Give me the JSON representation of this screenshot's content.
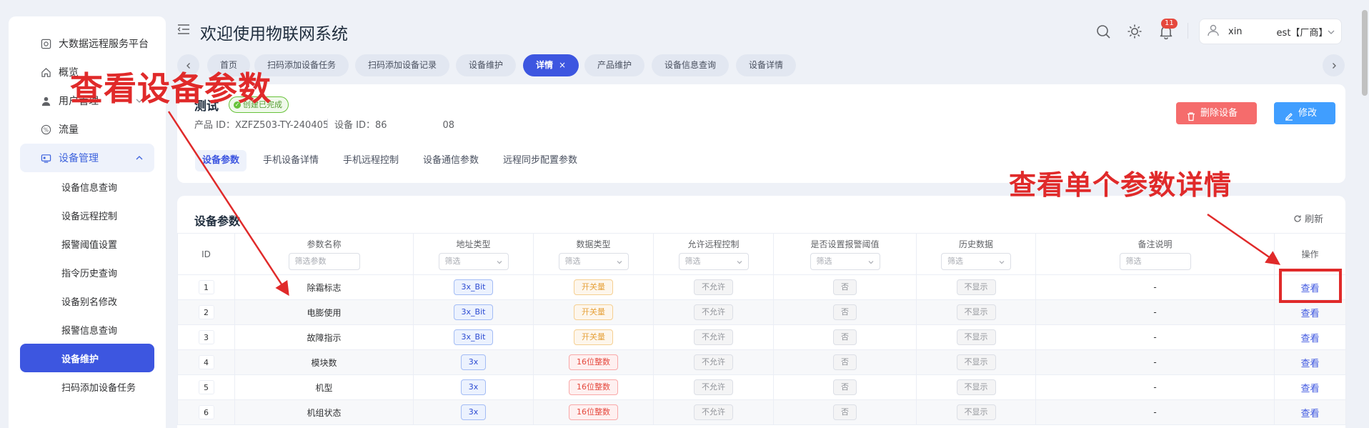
{
  "sidebar": {
    "items": [
      {
        "label": "大数据远程服务平台",
        "icon": "dashboard-icon"
      },
      {
        "label": "概览",
        "icon": "home-icon"
      },
      {
        "label": "用户管理",
        "icon": "user-icon",
        "expandable": true
      },
      {
        "label": "流量",
        "icon": "percent-icon"
      },
      {
        "label": "设备管理",
        "icon": "device-icon",
        "expanded": true
      }
    ],
    "sub_items": [
      "设备信息查询",
      "设备远程控制",
      "报警阈值设置",
      "指令历史查询",
      "设备别名修改",
      "报警信息查询",
      "设备维护",
      "扫码添加设备任务"
    ],
    "active_sub": "设备维护"
  },
  "header": {
    "title": "欢迎使用物联网系统",
    "notification_count": "11",
    "user": {
      "name_start": "xin",
      "name_end": "est【厂商】"
    }
  },
  "tabs": [
    {
      "label": "首页"
    },
    {
      "label": "扫码添加设备任务"
    },
    {
      "label": "扫码添加设备记录"
    },
    {
      "label": "设备维护"
    },
    {
      "label": "详情",
      "active": true,
      "close": "×"
    },
    {
      "label": "产品维护"
    },
    {
      "label": "设备信息查询"
    },
    {
      "label": "设备详情"
    }
  ],
  "device": {
    "name": "测试",
    "status": "创建已完成",
    "product_id_label": "产品 ID：",
    "product_id": "XZFZ503-TY-240405",
    "device_id_label": "设备 ID：",
    "device_id_start": "86",
    "device_id_end": "08",
    "delete_button": "删除设备",
    "edit_button": "修改"
  },
  "sub_tabs": [
    {
      "label": "设备参数",
      "active": true
    },
    {
      "label": "手机设备详情"
    },
    {
      "label": "手机远程控制"
    },
    {
      "label": "设备通信参数"
    },
    {
      "label": "远程同步配置参数"
    }
  ],
  "annotations": {
    "left": "查看设备参数",
    "right": "查看单个参数详情",
    "color": "#e02a2a"
  },
  "params_section": {
    "title": "设备参数",
    "refresh": "刷新",
    "columns": {
      "id": "ID",
      "name": "参数名称",
      "addr_type": "地址类型",
      "data_type": "数据类型",
      "remote": "允许远程控制",
      "alarm": "是否设置报警阈值",
      "history": "历史数据",
      "remark": "备注说明",
      "action": "操作"
    },
    "filters": {
      "name_placeholder": "筛选参数",
      "select_placeholder": "筛选",
      "remark_placeholder": "筛选"
    },
    "rows": [
      {
        "id": "1",
        "name": "除霜标志",
        "addr_type": "3x_Bit",
        "data_type": "开关量",
        "dt_style": "orange",
        "remote": "不允许",
        "alarm": "否",
        "history": "不显示",
        "remark": "-",
        "action": "查看"
      },
      {
        "id": "2",
        "name": "电膨使用",
        "addr_type": "3x_Bit",
        "data_type": "开关量",
        "dt_style": "orange",
        "remote": "不允许",
        "alarm": "否",
        "history": "不显示",
        "remark": "-",
        "action": "查看"
      },
      {
        "id": "3",
        "name": "故障指示",
        "addr_type": "3x_Bit",
        "data_type": "开关量",
        "dt_style": "orange",
        "remote": "不允许",
        "alarm": "否",
        "history": "不显示",
        "remark": "-",
        "action": "查看"
      },
      {
        "id": "4",
        "name": "模块数",
        "addr_type": "3x",
        "data_type": "16位整数",
        "dt_style": "red",
        "remote": "不允许",
        "alarm": "否",
        "history": "不显示",
        "remark": "-",
        "action": "查看"
      },
      {
        "id": "5",
        "name": "机型",
        "addr_type": "3x",
        "data_type": "16位整数",
        "dt_style": "red",
        "remote": "不允许",
        "alarm": "否",
        "history": "不显示",
        "remark": "-",
        "action": "查看"
      },
      {
        "id": "6",
        "name": "机组状态",
        "addr_type": "3x",
        "data_type": "16位整数",
        "dt_style": "red",
        "remote": "不允许",
        "alarm": "否",
        "history": "不显示",
        "remark": "-",
        "action": "查看"
      }
    ]
  }
}
